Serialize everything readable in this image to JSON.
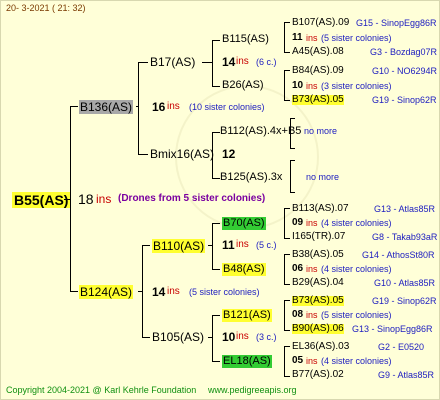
{
  "header": {
    "datetime": "20-  3-2021 ( 21: 32)"
  },
  "footer": {
    "copyright": "Copyright 2004-2021 @ Karl Kehrle Foundation",
    "site": "www.pedigreeapis.org"
  },
  "root": {
    "name": "B55(AS)",
    "count": "18",
    "ins": "ins",
    "drones": "(Drones from 5 sister colonies)"
  },
  "g1": [
    {
      "name": "B136(AS)",
      "count": "16",
      "ins": "ins",
      "sis": "(10 sister colonies)"
    },
    {
      "name": "B124(AS)",
      "count": "14",
      "ins": "ins",
      "sis": "(5 sister colonies)"
    }
  ],
  "g2": [
    {
      "name": "B17(AS)"
    },
    {
      "name": "Bmix16(AS)",
      "count": "12"
    },
    {
      "name": "B110(AS)",
      "count": "11",
      "ins": "ins",
      "sis": "(5 c.)"
    },
    {
      "name": "B105(AS)",
      "count": "10",
      "ins": "ins",
      "sis": "(3 c.)"
    }
  ],
  "g3": [
    {
      "name": "B115(AS)",
      "count": "14",
      "ins": "ins",
      "sis": "(6 c.)"
    },
    {
      "name": "B26(AS)"
    },
    {
      "name": "B112(AS).4x+B5",
      "note": "no more"
    },
    {
      "name": "B125(AS).3x",
      "note": "no more"
    },
    {
      "name": "B70(AS)"
    },
    {
      "name": "B48(AS)"
    },
    {
      "name": "B121(AS)"
    },
    {
      "name": "EL18(AS)"
    }
  ],
  "g4": [
    {
      "name": "B107(AS).09",
      "loc": "G15 - SinopEgg86R"
    },
    {
      "name": "11",
      "ins": "ins",
      "sis": "(5 sister colonies)"
    },
    {
      "name": "A45(AS).08",
      "loc": "G3 - Bozdag07R"
    },
    {
      "name": "B84(AS).09",
      "loc": "G10 - NO6294R"
    },
    {
      "name": "10",
      "ins": "ins",
      "sis": "(3 sister colonies)"
    },
    {
      "name": "B73(AS).05",
      "loc": "G19 - Sinop62R"
    },
    {
      "name": "B113(AS).07",
      "loc": "G13 - Atlas85R"
    },
    {
      "name": "09",
      "ins": "ins",
      "sis": "(4 sister colonies)"
    },
    {
      "name": "I165(TR).07",
      "loc": "G8 - Takab93aR"
    },
    {
      "name": "B38(AS).05",
      "loc": "G14 - AthosSt80R"
    },
    {
      "name": "06",
      "ins": "ins",
      "sis": "(4 sister colonies)"
    },
    {
      "name": "B29(AS).04",
      "loc": "G10 - Atlas85R"
    },
    {
      "name": "B73(AS).05",
      "loc": "G19 - Sinop62R"
    },
    {
      "name": "08",
      "ins": "ins",
      "sis": "(5 sister colonies)"
    },
    {
      "name": "B90(AS).06",
      "loc": "G13 - SinopEgg86R"
    },
    {
      "name": "EL36(AS).03",
      "loc": "G2 - E0520"
    },
    {
      "name": "05",
      "ins": "ins",
      "sis": "(4 sister colonies)"
    },
    {
      "name": "B77(AS).02",
      "loc": "G9 - Atlas85R"
    }
  ]
}
